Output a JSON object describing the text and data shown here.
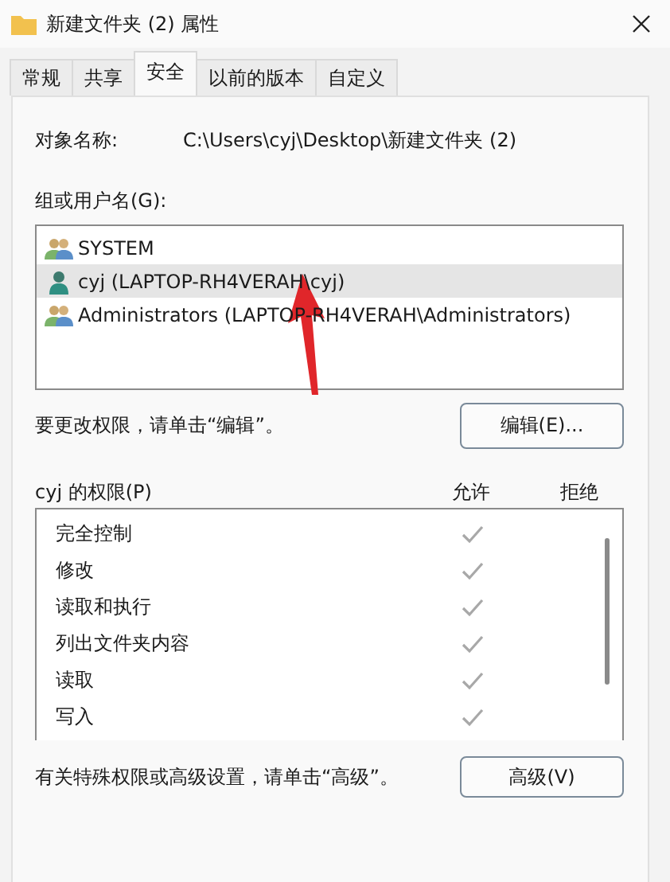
{
  "window": {
    "title": "新建文件夹 (2) 属性"
  },
  "tabs": [
    {
      "label": "常规",
      "selected": false
    },
    {
      "label": "共享",
      "selected": false
    },
    {
      "label": "安全",
      "selected": true
    },
    {
      "label": "以前的版本",
      "selected": false
    },
    {
      "label": "自定义",
      "selected": false
    }
  ],
  "object_name": {
    "label": "对象名称:",
    "value": "C:\\Users\\cyj\\Desktop\\新建文件夹 (2)"
  },
  "groups": {
    "label": "组或用户名(G):",
    "items": [
      {
        "name": "SYSTEM",
        "kind": "group",
        "selected": false
      },
      {
        "name": "cyj (LAPTOP-RH4VERAH\\cyj)",
        "kind": "user",
        "selected": true
      },
      {
        "name": "Administrators (LAPTOP-RH4VERAH\\Administrators)",
        "kind": "group",
        "selected": false
      }
    ]
  },
  "edit_hint": "要更改权限，请单击“编辑”。",
  "edit_button": "编辑(E)...",
  "permissions": {
    "label": "cyj 的权限(P)",
    "allow_header": "允许",
    "deny_header": "拒绝",
    "rows": [
      {
        "name": "完全控制",
        "allow": true
      },
      {
        "name": "修改",
        "allow": true
      },
      {
        "name": "读取和执行",
        "allow": true
      },
      {
        "name": "列出文件夹内容",
        "allow": true
      },
      {
        "name": "读取",
        "allow": true
      },
      {
        "name": "写入",
        "allow": true
      }
    ]
  },
  "advanced_hint": "有关特殊权限或高级设置，请单击“高级”。",
  "advanced_button": "高级(V)"
}
